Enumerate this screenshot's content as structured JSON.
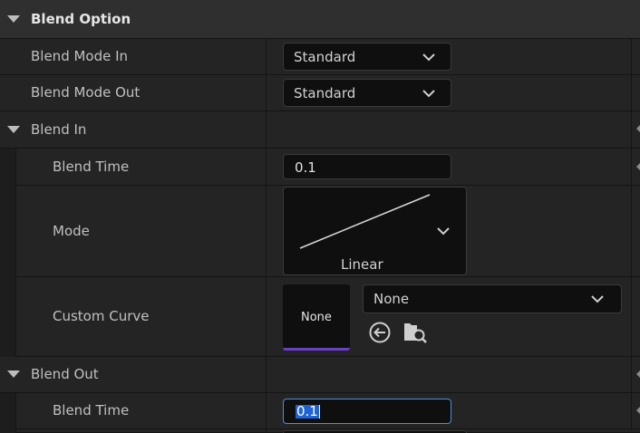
{
  "sections": {
    "blend_option": "Blend Option",
    "blend_in": "Blend In",
    "blend_out": "Blend Out"
  },
  "blend_option": {
    "mode_in_label": "Blend Mode In",
    "mode_in_value": "Standard",
    "mode_out_label": "Blend Mode Out",
    "mode_out_value": "Standard"
  },
  "blend_in": {
    "time_label": "Blend Time",
    "time_value": "0.1",
    "mode_label": "Mode",
    "mode_value": "Linear",
    "curve_label": "Custom Curve",
    "curve_thumb": "None",
    "curve_value": "None"
  },
  "blend_out": {
    "time_label": "Blend Time",
    "time_value": "0.1"
  },
  "colors": {
    "panel": "#242424",
    "header": "#2f2f2f",
    "field": "#0f0f0f",
    "focus": "#4a90e2",
    "selection": "#1f64d4",
    "curve_accent": "#6b3fc8"
  },
  "icons": [
    "chevron-down-icon",
    "use-selected-asset-icon",
    "browse-asset-icon",
    "linear-curve-icon"
  ]
}
